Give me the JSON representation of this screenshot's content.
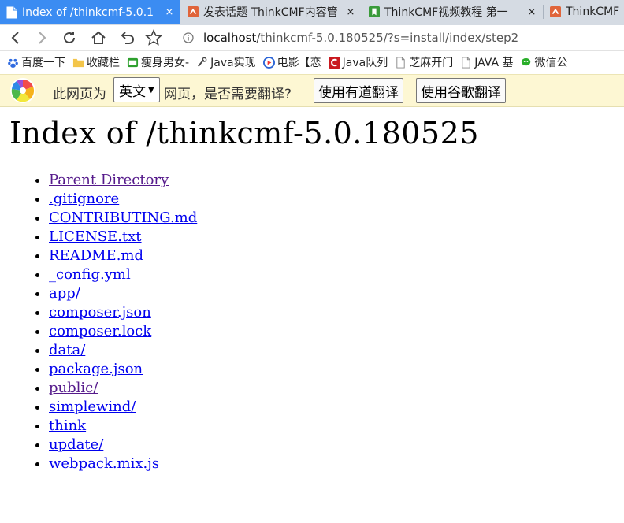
{
  "tabs": [
    {
      "title": "Index of /thinkcmf-5.0.1",
      "close": "×",
      "active": true
    },
    {
      "title": "发表话题 ThinkCMF内容管",
      "close": "×",
      "active": false
    },
    {
      "title": "ThinkCMF视频教程 第一",
      "close": "×",
      "active": false
    },
    {
      "title": "ThinkCMF",
      "close": "",
      "active": false
    }
  ],
  "address": {
    "host": "localhost",
    "path": "/thinkcmf-5.0.180525/?s=install/index/step2"
  },
  "bookmarks": [
    {
      "label": "百度一下",
      "icon": "paw-icon",
      "color": "#2f6ae0"
    },
    {
      "label": "收藏栏",
      "icon": "folder-icon",
      "color": "#f3c54a"
    },
    {
      "label": "瘦身男女-",
      "icon": "iqiyi-icon",
      "color": "#2ea02e"
    },
    {
      "label": "Java实现",
      "icon": "spoon-icon",
      "color": "#444444"
    },
    {
      "label": "电影【恋",
      "icon": "play-icon",
      "color": "#2a63d6"
    },
    {
      "label": "Java队列",
      "icon": "csdn-icon",
      "color": "#c9191f"
    },
    {
      "label": "芝麻开门",
      "icon": "page-icon",
      "color": "#888888"
    },
    {
      "label": "JAVA 基",
      "icon": "page-icon",
      "color": "#888888"
    },
    {
      "label": "微信公",
      "icon": "wechat-icon",
      "color": "#2aae2a"
    }
  ],
  "translate_bar": {
    "prefix": "此网页为",
    "language": "英文",
    "suffix": "网页，是否需要翻译?",
    "youdao_button": "使用有道翻译",
    "google_button": "使用谷歌翻译"
  },
  "page": {
    "title": "Index of /thinkcmf-5.0.180525",
    "entries": [
      {
        "name": "Parent Directory",
        "visited": true
      },
      {
        "name": ".gitignore",
        "visited": false
      },
      {
        "name": "CONTRIBUTING.md",
        "visited": false
      },
      {
        "name": "LICENSE.txt",
        "visited": false
      },
      {
        "name": "README.md",
        "visited": false
      },
      {
        "name": "_config.yml",
        "visited": false
      },
      {
        "name": "app/",
        "visited": false
      },
      {
        "name": "composer.json",
        "visited": false
      },
      {
        "name": "composer.lock",
        "visited": false
      },
      {
        "name": "data/",
        "visited": false
      },
      {
        "name": "package.json",
        "visited": false
      },
      {
        "name": "public/",
        "visited": true
      },
      {
        "name": "simplewind/",
        "visited": false
      },
      {
        "name": "think",
        "visited": false
      },
      {
        "name": "update/",
        "visited": false
      },
      {
        "name": "webpack.mix.js",
        "visited": false
      }
    ]
  },
  "colors": {
    "accent": "#3b8cf2",
    "link": "#0000ee",
    "visited": "#551a8b",
    "translate_bg": "#fdf7d3"
  }
}
